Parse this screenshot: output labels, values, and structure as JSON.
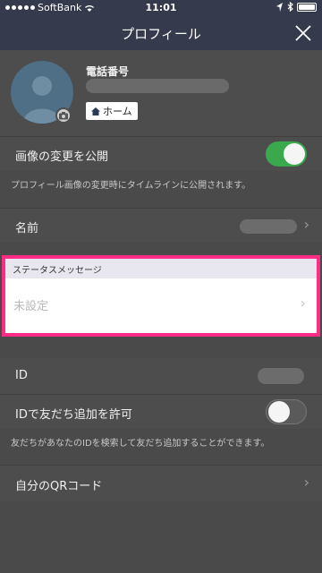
{
  "status_bar": {
    "carrier": "SoftBank",
    "time": "11:01"
  },
  "header": {
    "title": "プロフィール"
  },
  "profile": {
    "phone_label": "電話番号",
    "home_label": "ホーム"
  },
  "settings": {
    "publish_image_label": "画像の変更を公開",
    "publish_image_note": "プロフィール画像の変更時にタイムラインに公開されます。",
    "publish_image_on": true,
    "name_label": "名前",
    "status_header": "ステータスメッセージ",
    "status_value": "未設定",
    "id_label": "ID",
    "allow_id_label": "IDで友だち追加を許可",
    "allow_id_on": false,
    "allow_id_note": "友だちがあなたのIDを検索して友だち追加することができます。",
    "qr_label": "自分のQRコード"
  },
  "colors": {
    "highlight": "#ff2c86",
    "toggle_on": "#3aa84c",
    "header_bg": "#353a4c"
  }
}
